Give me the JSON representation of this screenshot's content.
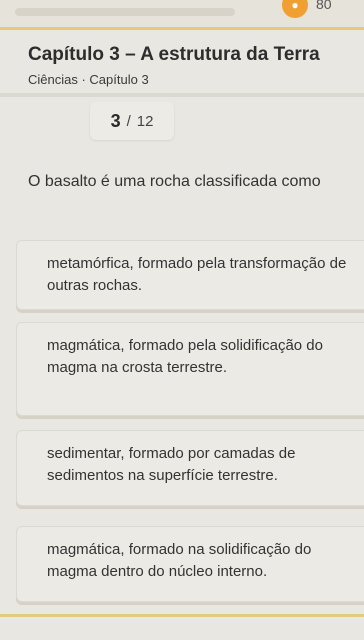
{
  "topbar": {
    "streak_icon": "flame-icon",
    "count": "80"
  },
  "header": {
    "title": "Capítulo 3 – A estrutura da Terra",
    "subtitle": "Ciências · Capítulo 3"
  },
  "progress": {
    "current": "3",
    "separator": "/",
    "total": "12"
  },
  "question": {
    "text": "O basalto é uma rocha classificada como"
  },
  "options": [
    {
      "text": "metamórfica, formado pela transformação de outras rochas."
    },
    {
      "text": "magmática, formado pela solidificação do magma na crosta terrestre."
    },
    {
      "text": "sedimentar, formado por camadas de sedimentos na superfície terrestre."
    },
    {
      "text": "magmática, formado na solidificação do magma dentro do núcleo interno."
    }
  ],
  "colors": {
    "accent": "#e8c777",
    "background": "#e9e7e1",
    "card": "#eceae5"
  }
}
